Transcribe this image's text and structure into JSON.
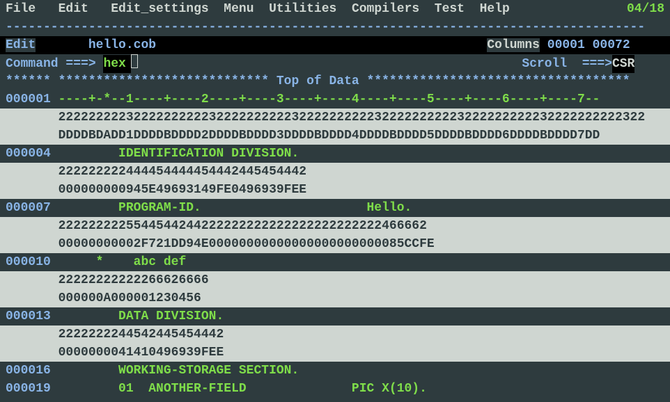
{
  "menu": {
    "file": "File",
    "edit": "Edit",
    "edit_settings": "Edit_settings",
    "menu": "Menu",
    "utilities": "Utilities",
    "compilers": "Compilers",
    "test": "Test",
    "help": "Help",
    "counter": "04/18"
  },
  "dash_line": "-------------------------------------------------------------------------------------",
  "edit_header": {
    "label": "Edit",
    "filename": "hello.cob",
    "columns_label": "Columns",
    "col_start": "00001",
    "col_end": "00072"
  },
  "command": {
    "label": "Command ===>",
    "value": "hex",
    "scroll_label": "Scroll  ===>",
    "scroll_value": "CSR"
  },
  "top_marker": "****** **************************** Top of Data ***********************************",
  "rows": [
    {
      "type": "ruler",
      "lineno": "000001",
      "text": "----+-*--1----+----2----+----3----+----4----+----5----+----6----+----7--"
    },
    {
      "type": "hex",
      "text": "222222222322222222223222222222232222222222322222222223222222222232222222222322"
    },
    {
      "type": "hex",
      "text": "DDDDBDADD1DDDDBDDDD2DDDDBDDDD3DDDDBDDDD4DDDDBDDDD5DDDDBDDDD6DDDDBDDDD7DD"
    },
    {
      "type": "code",
      "lineno": "000004",
      "text": "        IDENTIFICATION DIVISION."
    },
    {
      "type": "hex",
      "text": "222222222444454444454442445454442"
    },
    {
      "type": "hex",
      "text": "000000000945E49693149FE0496939FEE"
    },
    {
      "type": "code",
      "lineno": "000007",
      "text": "        PROGRAM-ID.                      Hello."
    },
    {
      "type": "hex",
      "text": "2222222225544544244222222222222222222222222466662"
    },
    {
      "type": "hex",
      "text": "00000000002F721DD94E00000000000000000000000085CCFE"
    },
    {
      "type": "code",
      "lineno": "000010",
      "text": "     *    abc def"
    },
    {
      "type": "hex",
      "text": "22222222222266626666"
    },
    {
      "type": "hex",
      "text": "000000A000001230456"
    },
    {
      "type": "code",
      "lineno": "000013",
      "text": "        DATA DIVISION."
    },
    {
      "type": "hex",
      "text": "2222222244542445454442"
    },
    {
      "type": "hex",
      "text": "0000000041410496939FEE"
    },
    {
      "type": "code",
      "lineno": "000016",
      "text": "        WORKING-STORAGE SECTION."
    },
    {
      "type": "code",
      "lineno": "000019",
      "text": "        01  ANOTHER-FIELD              PIC X(10)."
    }
  ]
}
